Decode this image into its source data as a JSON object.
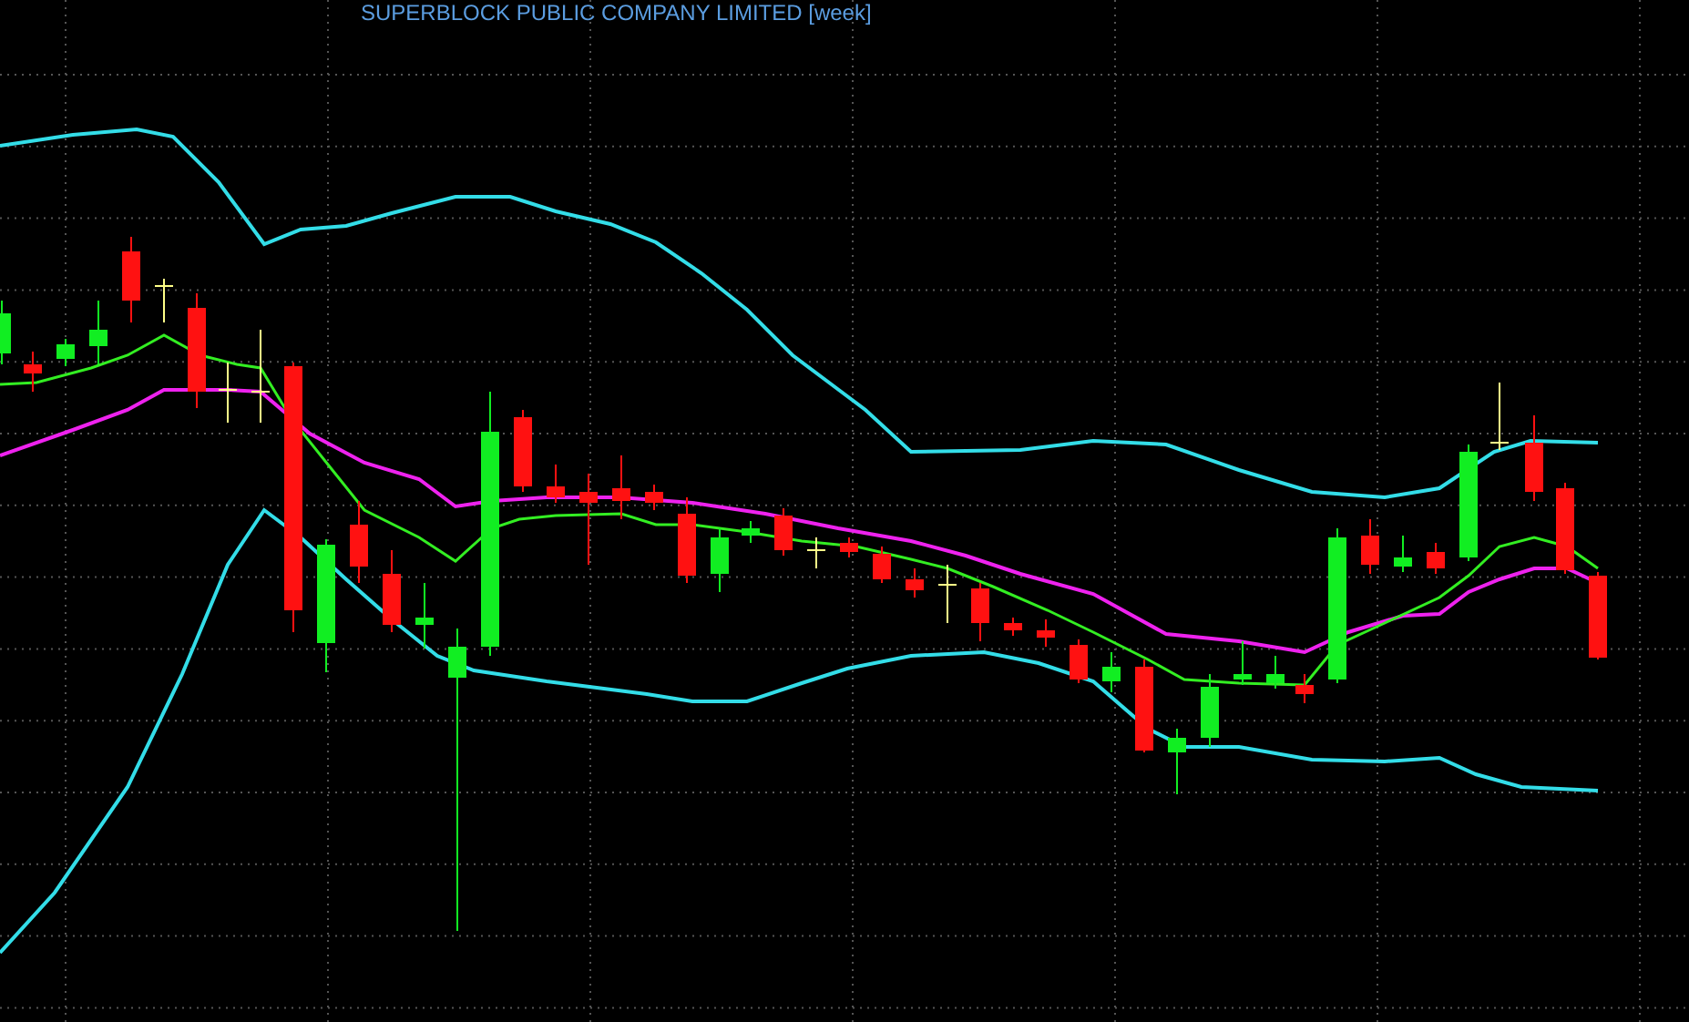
{
  "chart": {
    "title": "SUPERBLOCK PUBLIC COMPANY LIMITED [week]"
  }
}
